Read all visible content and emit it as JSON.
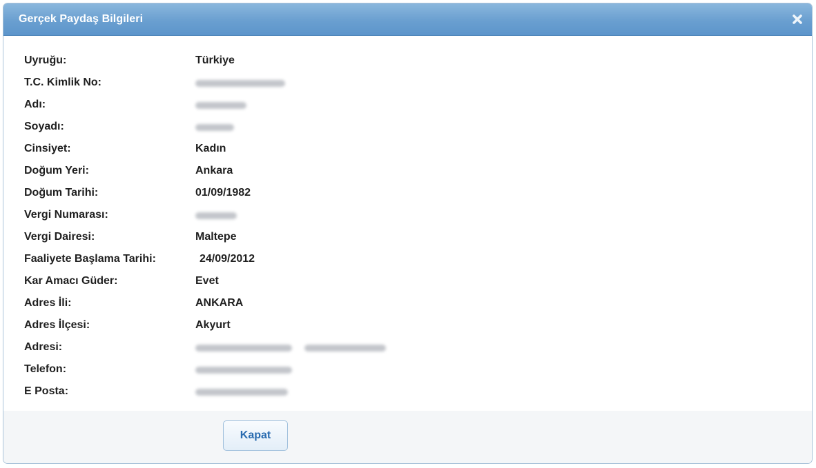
{
  "dialog": {
    "title": "Gerçek Paydaş Bilgileri",
    "close_icon": "close-x-icon",
    "colors": {
      "titlebar": "#6a9fd0",
      "button_text": "#2a6cb0"
    }
  },
  "fields": [
    {
      "label": "Uyruğu:",
      "value": "Türkiye",
      "redacted": false
    },
    {
      "label": "T.C. Kimlik No:",
      "value": "",
      "redacted": true
    },
    {
      "label": "Adı:",
      "value": "",
      "redacted": true
    },
    {
      "label": "Soyadı:",
      "value": "",
      "redacted": true
    },
    {
      "label": "Cinsiyet:",
      "value": "Kadın",
      "redacted": false
    },
    {
      "label": "Doğum Yeri:",
      "value": "Ankara",
      "redacted": false
    },
    {
      "label": "Doğum Tarihi:",
      "value": "01/09/1982",
      "redacted": false
    },
    {
      "label": "Vergi Numarası:",
      "value": "",
      "redacted": true
    },
    {
      "label": "Vergi Dairesi:",
      "value": "Maltepe",
      "redacted": false
    },
    {
      "label": "Faaliyete Başlama Tarihi:",
      "value": "24/09/2012",
      "redacted": false
    },
    {
      "label": "Kar Amacı Güder:",
      "value": "Evet",
      "redacted": false
    },
    {
      "label": "Adres İli:",
      "value": "ANKARA",
      "redacted": false
    },
    {
      "label": "Adres İlçesi:",
      "value": "Akyurt",
      "redacted": false
    },
    {
      "label": "Adresi:",
      "value": "",
      "redacted": true
    },
    {
      "label": "Telefon:",
      "value": "",
      "redacted": true
    },
    {
      "label": "E Posta:",
      "value": "",
      "redacted": true
    }
  ],
  "footer": {
    "close_label": "Kapat"
  }
}
